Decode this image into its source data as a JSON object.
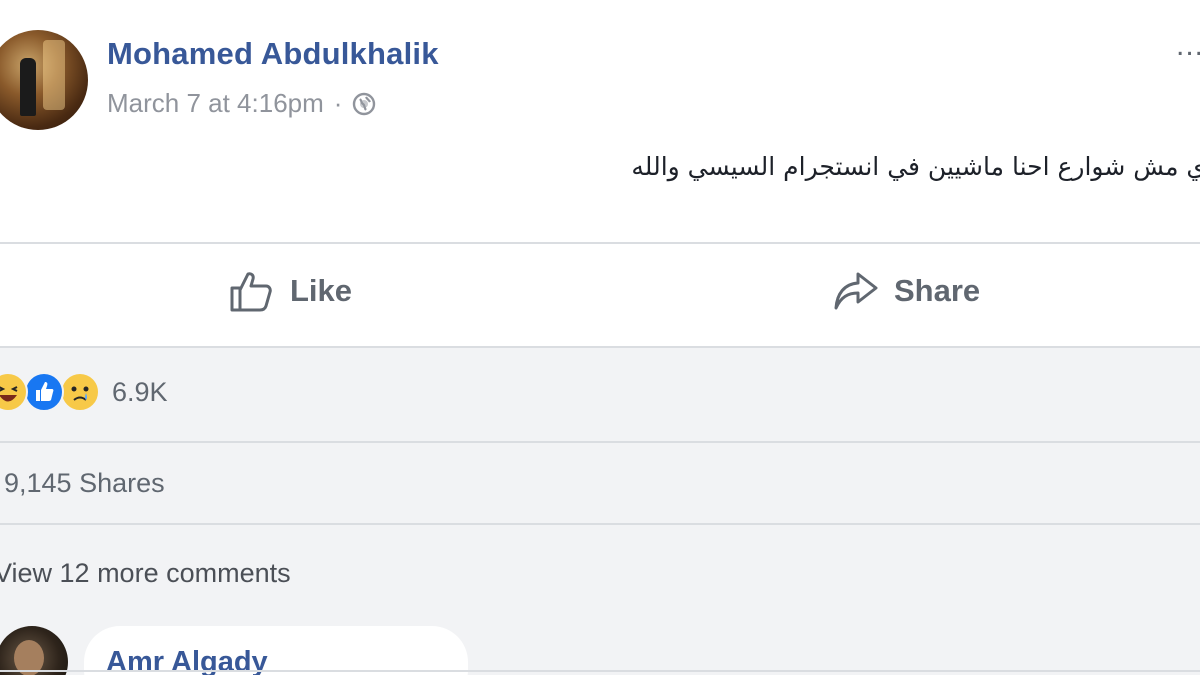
{
  "post": {
    "author_name": "Mohamed Abdulkhalik",
    "timestamp": "March 7 at 4:16pm",
    "separator": "·",
    "privacy_icon": "globe-icon",
    "more_icon": "...",
    "text": "ي مش شوارع احنا ماشيين في انستجرام السيسي والله"
  },
  "actions": {
    "like_label": "Like",
    "share_label": "Share"
  },
  "feedback": {
    "reactions": [
      "haha-icon",
      "like-icon",
      "sad-icon"
    ],
    "reaction_count": "6.9K",
    "shares": "9,145 Shares",
    "view_more": "View 12 more comments"
  },
  "comment": {
    "author_name": "Amr Algady"
  },
  "colors": {
    "link_blue": "#385898",
    "like_blue": "#1877f2",
    "reaction_yellow": "#f7c948",
    "muted_text": "#606770",
    "feedback_bg": "#f2f3f5"
  }
}
